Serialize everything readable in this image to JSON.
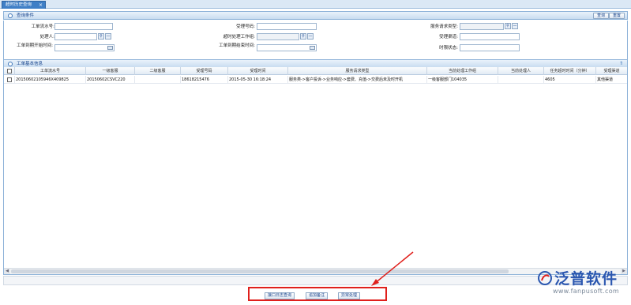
{
  "tab": {
    "label": "超时历史查询",
    "close": "×"
  },
  "query_panel": {
    "title": "查询条件",
    "search_label": "查询",
    "reset_label": "重置",
    "fields": {
      "ticket_no": {
        "label": "工单流水号:",
        "value": ""
      },
      "caller": {
        "label": "受理号码:",
        "value": ""
      },
      "service_type": {
        "label": "服务请求类型:",
        "value": ""
      },
      "handler": {
        "label": "处理人:",
        "value": ""
      },
      "timeout_group": {
        "label": "超时处理工作组:",
        "value": ""
      },
      "accept_channel": {
        "label": "受理渠道:",
        "value": ""
      },
      "deadline_start": {
        "label": "工单到期开始时间:",
        "value": ""
      },
      "deadline_end": {
        "label": "工单到期结束时间:",
        "value": ""
      },
      "time_status": {
        "label": "时限状态:",
        "value": ""
      }
    }
  },
  "grid_panel": {
    "title": "工单基本信息",
    "columns": [
      "",
      "工单流水号",
      "一级客服",
      "二级客服",
      "受理号码",
      "受理时间",
      "服务请求类型",
      "当前处理工作组",
      "当前处理人",
      "任务超时时间（分钟）",
      "受理渠道"
    ],
    "rows": [
      [
        "",
        "20150602105946X409825",
        "20150602CSVC220",
        "",
        "18618215476",
        "2015-05-30 16:18:24",
        "服务类->客户投诉->业务响应->套费、充值->交费后未及时开机",
        "一级客服部门104035",
        "",
        "4605",
        "其他渠道"
      ]
    ]
  },
  "bottom_buttons": {
    "interface_log": "接口日志查询",
    "add_note": "追加备注",
    "exception": "异常处理"
  },
  "logo": {
    "name": "泛普软件",
    "url": "www.fanpusoft.com"
  },
  "colors": {
    "accent": "#3f7fc6",
    "highlight_box": "#e0201c",
    "logo_blue": "#2b57b0"
  }
}
